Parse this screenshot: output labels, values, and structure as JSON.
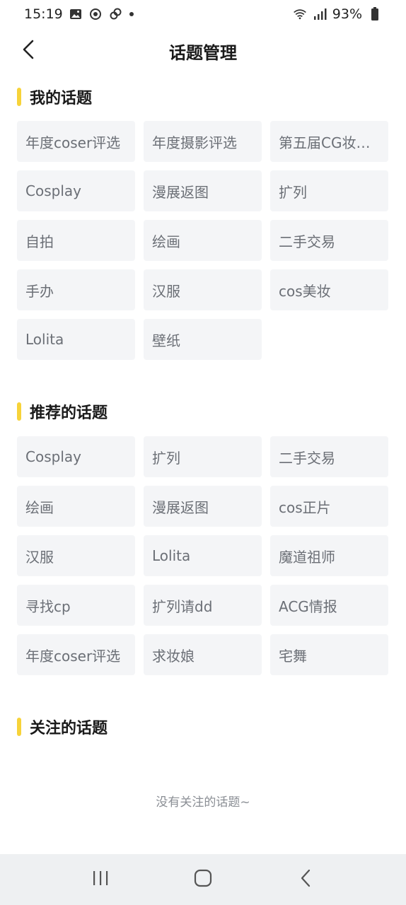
{
  "status_bar": {
    "time": "15:19",
    "battery": "93%",
    "icons_left": [
      "image-icon",
      "sync-icon",
      "link-icon",
      "dot-icon"
    ],
    "icons_right": [
      "wifi-icon",
      "signal-icon",
      "battery-icon"
    ]
  },
  "header": {
    "title": "话题管理",
    "back_icon": "chevron-left-icon"
  },
  "sections": {
    "my_topics": {
      "title": "我的话题",
      "items": [
        "年度coser评选",
        "年度摄影评选",
        "第五届CG妆…",
        "Cosplay",
        "漫展返图",
        "扩列",
        "自拍",
        "绘画",
        "二手交易",
        "手办",
        "汉服",
        "cos美妆",
        "Lolita",
        "壁纸"
      ]
    },
    "recommended_topics": {
      "title": "推荐的话题",
      "items": [
        "Cosplay",
        "扩列",
        "二手交易",
        "绘画",
        "漫展返图",
        "cos正片",
        "汉服",
        "Lolita",
        "魔道祖师",
        "寻找cp",
        "扩列请dd",
        "ACG情报",
        "年度coser评选",
        "求妆娘",
        "宅舞"
      ]
    },
    "followed_topics": {
      "title": "关注的话题",
      "empty_text": "没有关注的话题~"
    }
  },
  "colors": {
    "accent": "#f7d33a",
    "chip_bg": "#f4f5f7",
    "chip_text": "#6b6f76"
  },
  "nav_bar": {
    "buttons": [
      "recent-apps-icon",
      "home-icon",
      "back-icon"
    ]
  }
}
